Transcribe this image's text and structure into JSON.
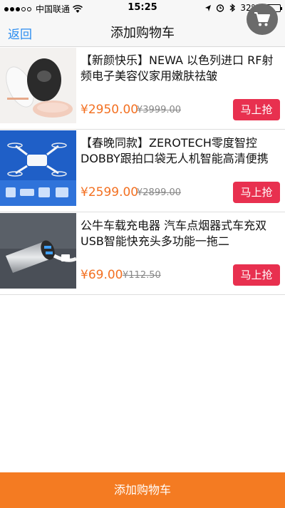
{
  "status_bar": {
    "carrier": "中国联通",
    "time": "15:25",
    "battery_percent": "32%",
    "battery_level": 0.32
  },
  "nav": {
    "back_label": "返回",
    "title": "添加购物车",
    "cart_icon": "shopping-cart-icon"
  },
  "products": [
    {
      "title": "【新颜快乐】NEWA 以色列进口 RF射频电子美容仪家用嫩肤祛皱",
      "price": "¥2950.00",
      "old_price": "¥3999.00",
      "buy_label": "马上抢"
    },
    {
      "title": "【春晚同款】ZEROTECH零度智控DOBBY跟拍口袋无人机智能高清便携",
      "price": "¥2599.00",
      "old_price": "¥2899.00",
      "buy_label": "马上抢"
    },
    {
      "title": "公牛车载充电器 汽车点烟器式车充双USB智能快充头多功能一拖二",
      "price": "¥69.00",
      "old_price": "¥112.50",
      "buy_label": "马上抢"
    }
  ],
  "footer": {
    "add_to_cart_label": "添加购物车"
  },
  "colors": {
    "accent_blue": "#2a8cf0",
    "price_orange": "#f37021",
    "buy_red": "#e8304f",
    "footer_orange": "#f47b22"
  }
}
